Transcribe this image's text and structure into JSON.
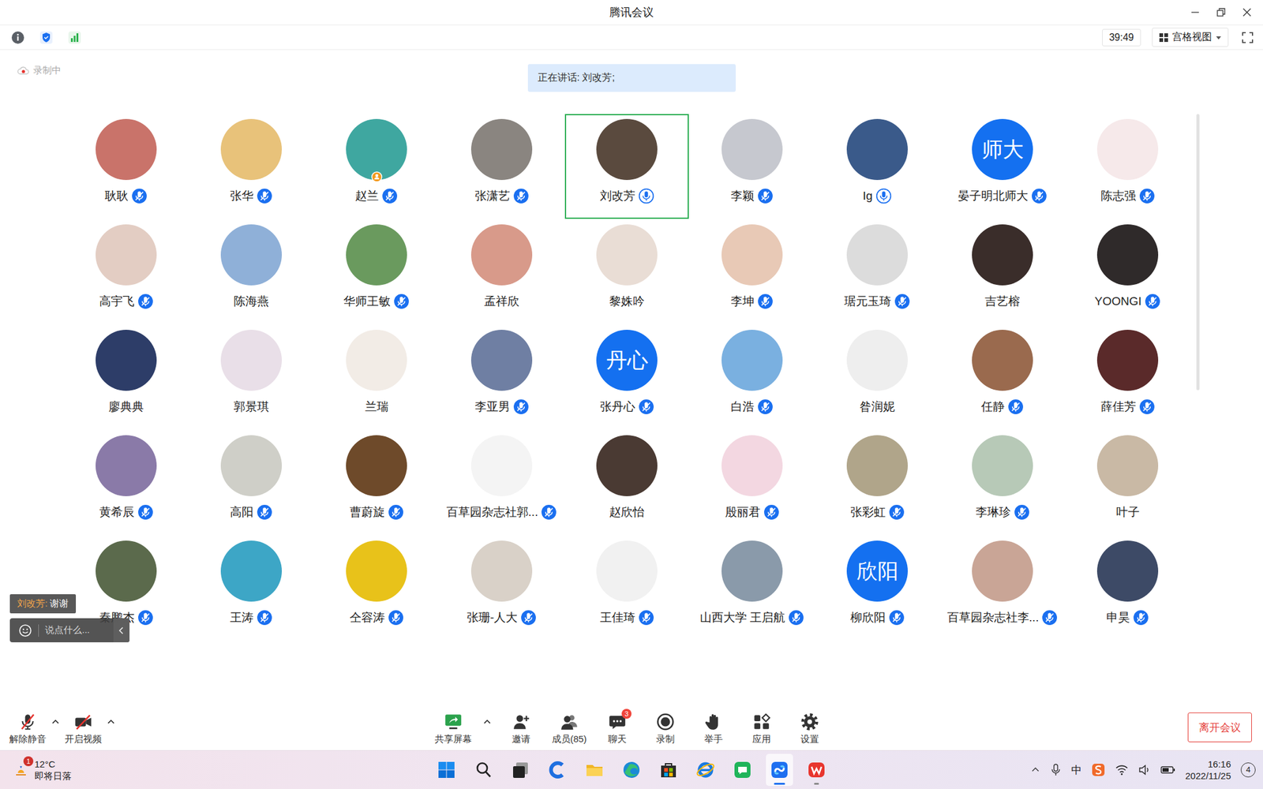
{
  "window": {
    "title": "腾讯会议"
  },
  "toolbar": {
    "timer": "39:49",
    "view": "宫格视图"
  },
  "recording": "录制中",
  "speaking": "正在讲话: 刘改芳;",
  "participants": [
    {
      "name": "耿耿",
      "color": "#c9736a",
      "mic": "muted",
      "host": false,
      "speaking": false
    },
    {
      "name": "张华",
      "color": "#e8c27a",
      "mic": "muted",
      "host": false,
      "speaking": false
    },
    {
      "name": "赵兰",
      "color": "#3fa7a0",
      "mic": "muted",
      "host": true,
      "speaking": false
    },
    {
      "name": "张潇艺",
      "color": "#8a8580",
      "mic": "muted",
      "host": false,
      "speaking": false
    },
    {
      "name": "刘改芳",
      "color": "#5a4a3e",
      "mic": "on",
      "host": false,
      "speaking": true
    },
    {
      "name": "李颖",
      "color": "#c6c8cf",
      "mic": "muted",
      "host": false,
      "speaking": false
    },
    {
      "name": "Ig",
      "color": "#3a5a8a",
      "mic": "on",
      "host": false,
      "speaking": false
    },
    {
      "name": "晏子明北师大",
      "color": "#1470f0",
      "avatarText": "师大",
      "mic": "muted",
      "host": false,
      "speaking": false
    },
    {
      "name": "陈志强",
      "color": "#f6e9ea",
      "mic": "muted",
      "host": false,
      "speaking": false
    },
    {
      "name": "高宇飞",
      "color": "#e3cdc3",
      "mic": "muted",
      "host": false,
      "speaking": false
    },
    {
      "name": "陈海燕",
      "color": "#8fb0d8",
      "mic": "none",
      "host": false,
      "speaking": false
    },
    {
      "name": "华师王敏",
      "color": "#6a9a5e",
      "mic": "muted",
      "host": false,
      "speaking": false
    },
    {
      "name": "孟祥欣",
      "color": "#d89a8a",
      "mic": "none",
      "host": false,
      "speaking": false
    },
    {
      "name": "黎姝吟",
      "color": "#e9ddd5",
      "mic": "none",
      "host": false,
      "speaking": false
    },
    {
      "name": "李坤",
      "color": "#e8c9b6",
      "mic": "muted",
      "host": false,
      "speaking": false
    },
    {
      "name": "琚元玉琦",
      "color": "#dcdcdc",
      "mic": "muted",
      "host": false,
      "speaking": false
    },
    {
      "name": "吉艺榕",
      "color": "#3a2d2a",
      "mic": "none",
      "host": false,
      "speaking": false
    },
    {
      "name": "YOONGI",
      "color": "#2f2a2a",
      "mic": "muted",
      "host": false,
      "speaking": false
    },
    {
      "name": "廖典典",
      "color": "#2d3d68",
      "mic": "none",
      "host": false,
      "speaking": false
    },
    {
      "name": "郭景琪",
      "color": "#e9dfe8",
      "mic": "none",
      "host": false,
      "speaking": false
    },
    {
      "name": "兰瑞",
      "color": "#f2ece6",
      "mic": "none",
      "host": false,
      "speaking": false
    },
    {
      "name": "李亚男",
      "color": "#6f7fa3",
      "mic": "muted",
      "host": false,
      "speaking": false
    },
    {
      "name": "张丹心",
      "color": "#1470f0",
      "avatarText": "丹心",
      "mic": "muted",
      "host": false,
      "speaking": false
    },
    {
      "name": "白浩",
      "color": "#7ab0e0",
      "mic": "muted",
      "host": false,
      "speaking": false
    },
    {
      "name": "昝润妮",
      "color": "#eeeeee",
      "mic": "none",
      "host": false,
      "speaking": false
    },
    {
      "name": "任静",
      "color": "#9a6a4e",
      "mic": "muted",
      "host": false,
      "speaking": false
    },
    {
      "name": "薛佳芳",
      "color": "#5a2a2a",
      "mic": "muted",
      "host": false,
      "speaking": false
    },
    {
      "name": "黄希辰",
      "color": "#8a7aa8",
      "mic": "muted",
      "host": false,
      "speaking": false
    },
    {
      "name": "高阳",
      "color": "#cfcfc8",
      "mic": "muted",
      "host": false,
      "speaking": false
    },
    {
      "name": "曹蔚旋",
      "color": "#6e4a2a",
      "mic": "muted",
      "host": false,
      "speaking": false
    },
    {
      "name": "百草园杂志社郭...",
      "color": "#f4f4f4",
      "mic": "muted",
      "host": false,
      "speaking": false
    },
    {
      "name": "赵欣怡",
      "color": "#4a3a33",
      "mic": "none",
      "host": false,
      "speaking": false
    },
    {
      "name": "殷丽君",
      "color": "#f3d7e1",
      "mic": "muted",
      "host": false,
      "speaking": false
    },
    {
      "name": "张彩虹",
      "color": "#b0a58a",
      "mic": "muted",
      "host": false,
      "speaking": false
    },
    {
      "name": "李琳珍",
      "color": "#b7c9b7",
      "mic": "muted",
      "host": false,
      "speaking": false
    },
    {
      "name": "叶子",
      "color": "#c9b9a5",
      "mic": "none",
      "host": false,
      "speaking": false
    },
    {
      "name": "秦鹏杰",
      "color": "#5b6a4c",
      "mic": "muted",
      "host": false,
      "speaking": false
    },
    {
      "name": "王涛",
      "color": "#3da6c6",
      "mic": "muted",
      "host": false,
      "speaking": false
    },
    {
      "name": "仝容涛",
      "color": "#e8c21a",
      "mic": "muted",
      "host": false,
      "speaking": false
    },
    {
      "name": "张珊-人大",
      "color": "#d9d1c8",
      "mic": "muted",
      "host": false,
      "speaking": false
    },
    {
      "name": "王佳琦",
      "color": "#f1f1f1",
      "mic": "muted",
      "host": false,
      "speaking": false
    },
    {
      "name": "山西大学 王启航",
      "color": "#8a9aaa",
      "mic": "muted",
      "host": false,
      "speaking": false
    },
    {
      "name": "柳欣阳",
      "color": "#1470f0",
      "avatarText": "欣阳",
      "mic": "muted",
      "host": false,
      "speaking": false
    },
    {
      "name": "百草园杂志社李...",
      "color": "#c9a596",
      "mic": "muted",
      "host": false,
      "speaking": false
    },
    {
      "name": "申昊",
      "color": "#3d4a66",
      "mic": "muted",
      "host": false,
      "speaking": false
    }
  ],
  "chat": {
    "sender": "刘改芳:",
    "message": "谢谢",
    "placeholder": "说点什么..."
  },
  "mediaControls": [
    {
      "label": "解除静音",
      "kind": "mic",
      "menu": true
    },
    {
      "label": "开启视频",
      "kind": "video",
      "menu": true
    }
  ],
  "meetingControls": [
    {
      "label": "共享屏幕",
      "kind": "share",
      "menu": true
    },
    {
      "label": "邀请",
      "kind": "invite",
      "menu": false
    },
    {
      "label": "成员(85)",
      "kind": "members",
      "menu": false
    },
    {
      "label": "聊天",
      "kind": "chat",
      "menu": false,
      "badge": "3"
    },
    {
      "label": "录制",
      "kind": "record",
      "menu": false
    },
    {
      "label": "举手",
      "kind": "hand",
      "menu": false
    },
    {
      "label": "应用",
      "kind": "apps",
      "menu": false
    },
    {
      "label": "设置",
      "kind": "settings",
      "menu": false
    }
  ],
  "leave": "离开会议",
  "taskbar": {
    "weather": {
      "temp": "12°C",
      "text": "即将日落",
      "badge": "1"
    },
    "apps": [
      {
        "kind": "windows",
        "active": false,
        "focused": false
      },
      {
        "kind": "search",
        "active": false,
        "focused": false
      },
      {
        "kind": "taskview",
        "active": false,
        "focused": false
      },
      {
        "kind": "assistant",
        "active": false,
        "focused": false
      },
      {
        "kind": "folder",
        "active": false,
        "focused": false
      },
      {
        "kind": "edge",
        "active": false,
        "focused": false
      },
      {
        "kind": "store",
        "active": false,
        "focused": false
      },
      {
        "kind": "ie",
        "active": false,
        "focused": false
      },
      {
        "kind": "green",
        "active": false,
        "focused": false
      },
      {
        "kind": "meeting",
        "active": true,
        "focused": true
      },
      {
        "kind": "wps",
        "active": true,
        "focused": false
      }
    ],
    "ime": "中",
    "time": "16:16",
    "date": "2022/11/25",
    "notifications": "4"
  }
}
